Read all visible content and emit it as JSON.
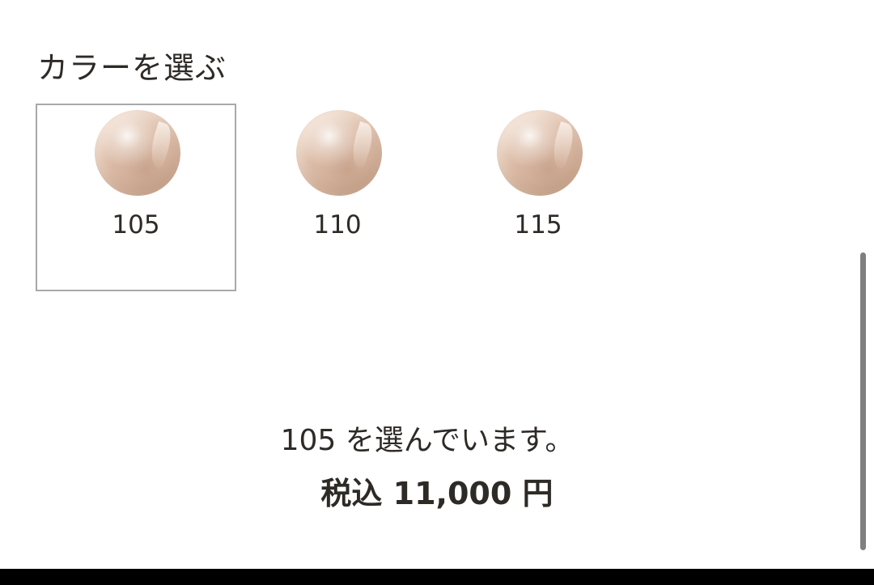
{
  "section": {
    "title": "カラーを選ぶ"
  },
  "swatches": [
    {
      "label": "105",
      "selected": true,
      "color": "#dcbca7"
    },
    {
      "label": "110",
      "selected": false,
      "color": "#dcbca7"
    },
    {
      "label": "115",
      "selected": false,
      "color": "#dcbca7"
    }
  ],
  "selection": {
    "text": "105 を選んでいます。"
  },
  "price": {
    "prefix": "税込",
    "amount": "11,000",
    "currency": "円"
  }
}
